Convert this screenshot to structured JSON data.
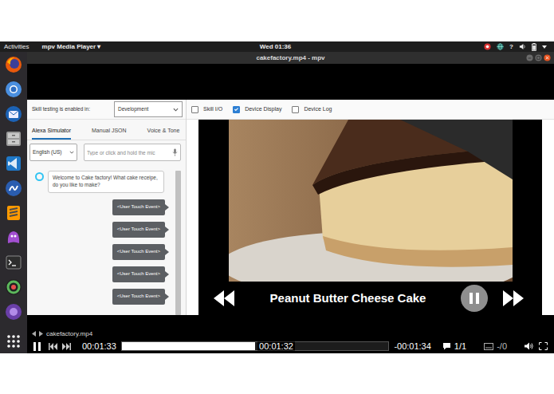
{
  "topbar": {
    "activities": "Activities",
    "app_menu": "mpv Media Player ▾",
    "clock": "Wed 01:36",
    "help": "?"
  },
  "window": {
    "title": "cakefactory.mp4 - mpv"
  },
  "console": {
    "testing_label": "Skill testing is enabled in:",
    "stage": "Development",
    "toggles": [
      {
        "label": "Skill I/O",
        "checked": false
      },
      {
        "label": "Device Display",
        "checked": true
      },
      {
        "label": "Device Log",
        "checked": false
      }
    ],
    "tabs": [
      {
        "label": "Alexa Simulator",
        "selected": true
      },
      {
        "label": "Manual JSON",
        "selected": false
      },
      {
        "label": "Voice & Tone",
        "selected": false
      }
    ],
    "language": "English (US)",
    "input_placeholder": "Type or click and hold the mic",
    "messages": [
      {
        "kind": "alexa",
        "text": "Welcome to Cake factory! What cake receipe, do you like to make?"
      },
      {
        "kind": "user",
        "text": "<User Touch Event>"
      },
      {
        "kind": "user",
        "text": "<User Touch Event>"
      },
      {
        "kind": "user",
        "text": "<User Touch Event>"
      },
      {
        "kind": "user",
        "text": "<User Touch Event>"
      },
      {
        "kind": "user",
        "text": "<User Touch Event>"
      }
    ]
  },
  "device_display": {
    "caption": "Peanut Butter Cheese Cake",
    "playing": true
  },
  "player": {
    "filename": "cakefactory.mp4",
    "playing": true,
    "elapsed": "00:01:33",
    "hover_time": "00:01:32",
    "remaining": "-00:01:34",
    "level": 0.5,
    "audio_track": "1/1",
    "subtitle_track": "-/0"
  }
}
